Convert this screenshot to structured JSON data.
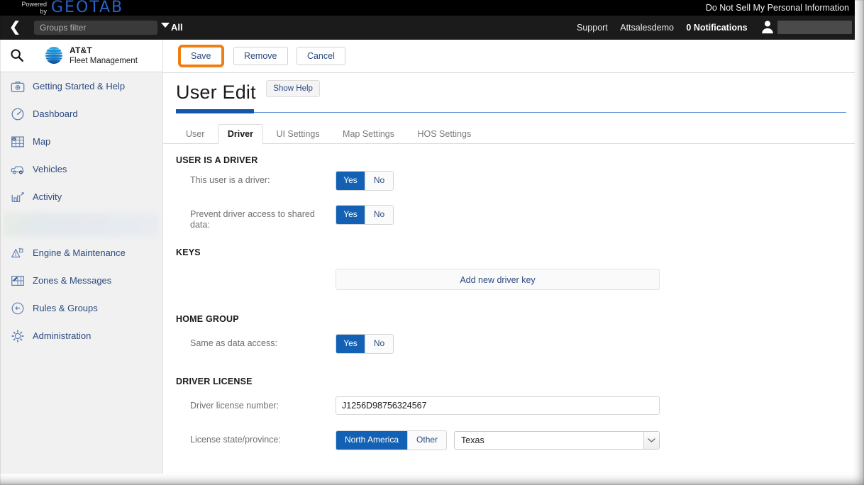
{
  "brandbar": {
    "powered_line1": "Powered",
    "powered_line2": "by",
    "geotab": "GEOTAB",
    "do_not_sell": "Do Not Sell My Personal Information"
  },
  "navstrip": {
    "back_icon": "chevron-left-icon",
    "groups_filter_placeholder": "Groups filter",
    "groups_filter_value": "",
    "all_label": "All",
    "support": "Support",
    "account": "Attsalesdemo",
    "notifications": "0 Notifications",
    "avatar_icon": "user-avatar-icon"
  },
  "sidebar": {
    "search_icon": "search-icon",
    "logo_icon": "att-globe-icon",
    "brand_line1": "AT&T",
    "brand_line2": "Fleet Management",
    "items": [
      {
        "label": "Getting Started & Help",
        "icon": "help-kit-icon"
      },
      {
        "label": "Dashboard",
        "icon": "gauge-icon"
      },
      {
        "label": "Map",
        "icon": "map-grid-icon"
      },
      {
        "label": "Vehicles",
        "icon": "vehicle-icon"
      },
      {
        "label": "Activity",
        "icon": "bar-chart-icon"
      },
      {
        "label": "",
        "icon": "redacted-icon",
        "redacted": true
      },
      {
        "label": "Engine & Maintenance",
        "icon": "engine-warning-icon"
      },
      {
        "label": "Zones & Messages",
        "icon": "zones-pencil-icon"
      },
      {
        "label": "Rules & Groups",
        "icon": "rules-arrow-icon"
      },
      {
        "label": "Administration",
        "icon": "gear-icon"
      }
    ]
  },
  "toolbar": {
    "save_label": "Save",
    "remove_label": "Remove",
    "cancel_label": "Cancel",
    "highlight_color": "#f07f13"
  },
  "page": {
    "title": "User Edit",
    "show_help_label": "Show Help"
  },
  "tabs": [
    {
      "label": "User",
      "active": false
    },
    {
      "label": "Driver",
      "active": true
    },
    {
      "label": "UI Settings",
      "active": false
    },
    {
      "label": "Map Settings",
      "active": false
    },
    {
      "label": "HOS Settings",
      "active": false
    }
  ],
  "form": {
    "section_user_is_a_driver": "USER IS A DRIVER",
    "is_driver_label": "This user is a driver:",
    "is_driver_yes": "Yes",
    "is_driver_no": "No",
    "is_driver_value": "Yes",
    "prevent_access_label": "Prevent driver access to shared data:",
    "prevent_access_yes": "Yes",
    "prevent_access_no": "No",
    "prevent_access_value": "Yes",
    "section_keys": "KEYS",
    "add_key_label": "Add new driver key",
    "section_home_group": "HOME GROUP",
    "same_as_data_access_label": "Same as data access:",
    "same_as_data_access_yes": "Yes",
    "same_as_data_access_no": "No",
    "same_as_data_access_value": "Yes",
    "section_driver_license": "DRIVER LICENSE",
    "license_number_label": "Driver license number:",
    "license_number_value": "J1256D98756324567",
    "license_state_label": "License state/province:",
    "region_north_america": "North America",
    "region_other": "Other",
    "region_value": "North America",
    "state_value": "Texas"
  },
  "colors": {
    "accent_blue": "#1261b5",
    "link_blue": "#2c4a80",
    "highlight_orange": "#f07f13",
    "sidebar_bg": "#f1f1f1"
  }
}
